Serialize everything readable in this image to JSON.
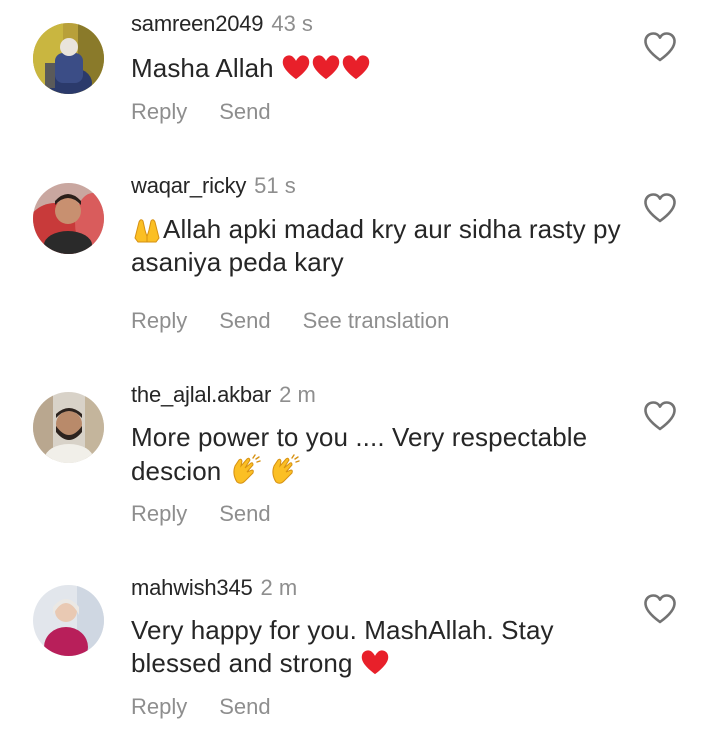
{
  "labels": {
    "reply": "Reply",
    "send": "Send",
    "see_translation": "See translation"
  },
  "comments": [
    {
      "username": "samreen2049",
      "time": "43 s",
      "text": "Masha Allah",
      "avatar": "woman-in-blue-avatar"
    },
    {
      "username": "waqar_ricky",
      "time": "51 s",
      "text": "Allah apki madad kry aur sidha rasty py asaniya peda kary",
      "avatar": "man-in-car-avatar"
    },
    {
      "username": "the_ajlal.akbar",
      "time": "2 m",
      "text": "More power to you .... Very respectable descion",
      "avatar": "man-with-beard-avatar"
    },
    {
      "username": "mahwish345",
      "time": "2 m",
      "text": "Very happy for you. MashAllah. Stay blessed and strong",
      "avatar": "woman-in-pink-avatar"
    }
  ],
  "colors": {
    "text": "#262626",
    "secondary": "#8e8e8e",
    "heart": "#e8202a"
  }
}
